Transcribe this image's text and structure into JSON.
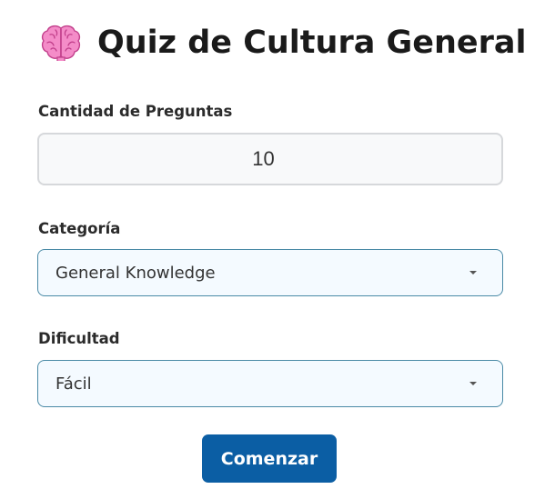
{
  "quiz": {
    "title": "Quiz de Cultura General",
    "title_icon": "brain-icon"
  },
  "form": {
    "quantity": {
      "label": "Cantidad de Preguntas",
      "value": "10"
    },
    "category": {
      "label": "Categoría",
      "selected": "General Knowledge"
    },
    "difficulty": {
      "label": "Dificultad",
      "selected": "Fácil"
    },
    "submit_label": "Comenzar"
  },
  "colors": {
    "button_bg": "#0b5ea4",
    "select_border": "#4a8aa6",
    "select_bg": "#f4faff",
    "brain": "#f06bb8"
  }
}
